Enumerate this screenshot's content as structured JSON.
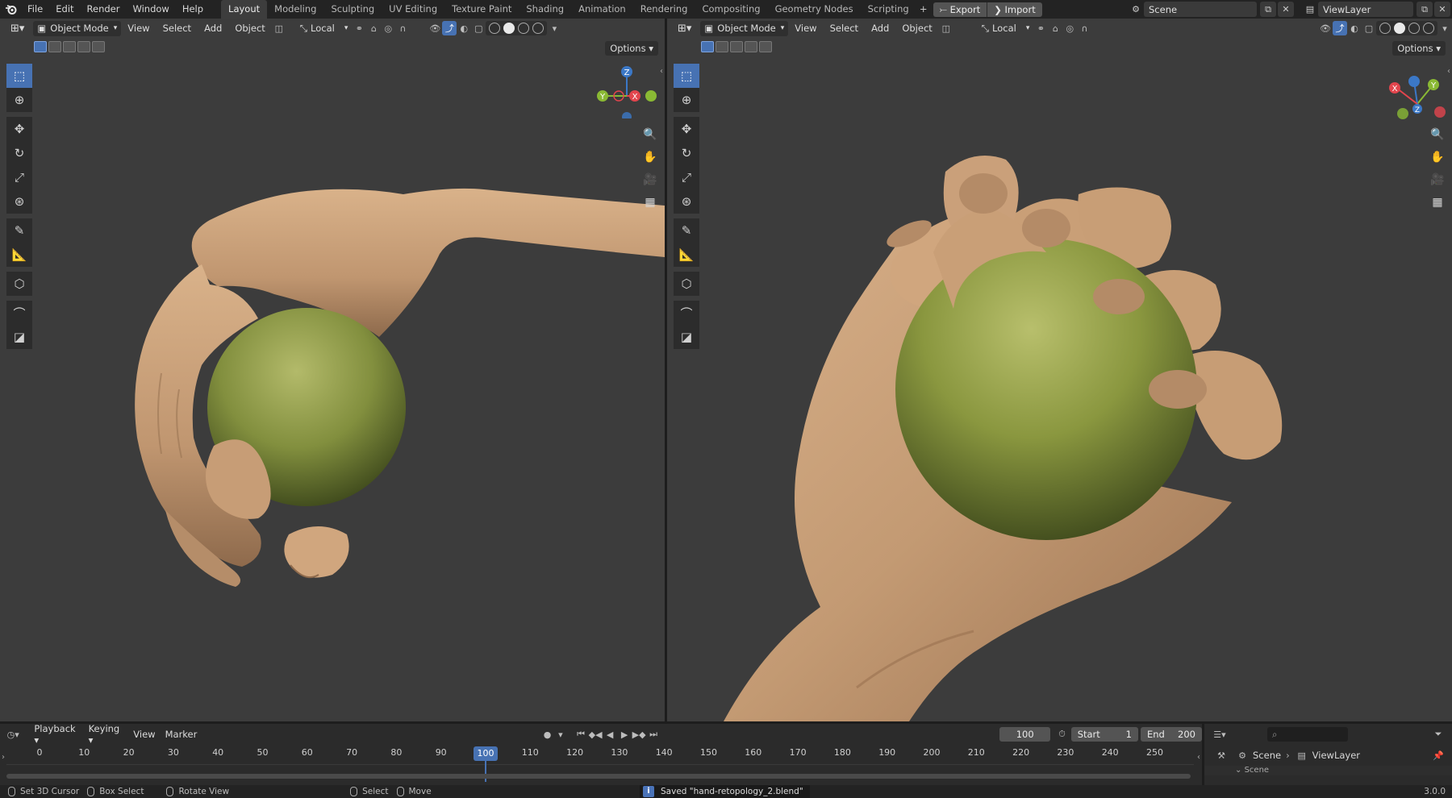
{
  "topbar": {
    "menus": [
      "File",
      "Edit",
      "Render",
      "Window",
      "Help"
    ],
    "workspaces": [
      "Layout",
      "Modeling",
      "Sculpting",
      "UV Editing",
      "Texture Paint",
      "Shading",
      "Animation",
      "Rendering",
      "Compositing",
      "Geometry Nodes",
      "Scripting"
    ],
    "active_workspace": "Layout",
    "export_label": "Export",
    "import_label": "Import",
    "scene": "Scene",
    "view_layer": "ViewLayer"
  },
  "viewport": {
    "mode": "Object Mode",
    "menus": [
      "View",
      "Select",
      "Add",
      "Object"
    ],
    "transform_orientation": "Local",
    "options_label": "Options",
    "gizmo_axes": {
      "x": "X",
      "y": "Y",
      "z": "Z"
    },
    "colors": {
      "x_axis": "#e2454d",
      "y_axis": "#8ab934",
      "z_axis": "#3b78c7",
      "skin": "#c9a07a",
      "ball": "#8c9a46",
      "background": "#3c3c3c",
      "accent": "#4772b3"
    }
  },
  "timeline": {
    "menus": [
      "Playback",
      "Keying",
      "View",
      "Marker"
    ],
    "current_frame": "100",
    "start_label": "Start",
    "start_value": "1",
    "end_label": "End",
    "end_value": "200",
    "ticks": [
      "0",
      "10",
      "20",
      "30",
      "40",
      "50",
      "60",
      "70",
      "80",
      "90",
      "100",
      "110",
      "120",
      "130",
      "140",
      "150",
      "160",
      "170",
      "180",
      "190",
      "200",
      "210",
      "220",
      "230",
      "240",
      "250"
    ]
  },
  "outliner": {
    "scene": "Scene",
    "view_layer": "ViewLayer",
    "partial_row": "Scene"
  },
  "statusbar": {
    "hints": [
      "Set 3D Cursor",
      "Box Select",
      "Rotate View",
      "Select",
      "Move"
    ],
    "message": "Saved \"hand-retopology_2.blend\"",
    "version": "3.0.0"
  }
}
